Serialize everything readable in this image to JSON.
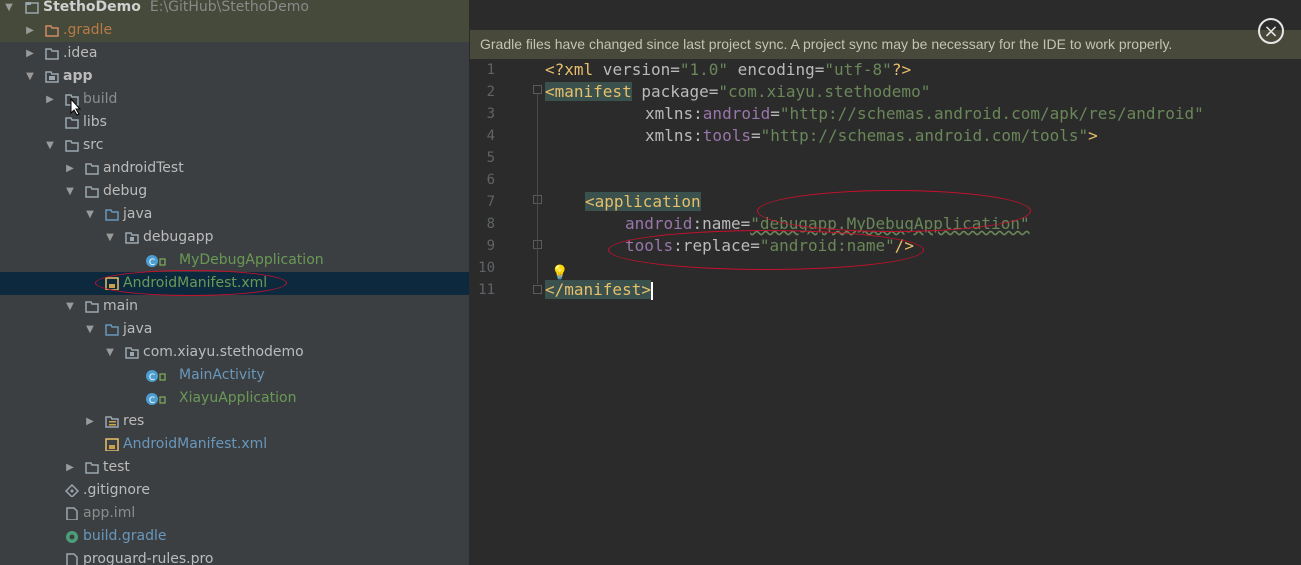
{
  "project_tree": {
    "rows": [
      {
        "label": "StethoDemo",
        "path": "E:\\GitHub\\StethoDemo",
        "type": "project"
      },
      {
        "label": ".gradle",
        "type": "folder"
      },
      {
        "label": ".idea",
        "type": "folder"
      },
      {
        "label": "app",
        "type": "module"
      },
      {
        "label": "build",
        "type": "folder"
      },
      {
        "label": "libs",
        "type": "folder"
      },
      {
        "label": "src",
        "type": "folder"
      },
      {
        "label": "androidTest",
        "type": "folder"
      },
      {
        "label": "debug",
        "type": "folder"
      },
      {
        "label": "java",
        "type": "folder"
      },
      {
        "label": "debugapp",
        "type": "package"
      },
      {
        "label": "MyDebugApplication",
        "type": "class"
      },
      {
        "label": "AndroidManifest.xml",
        "type": "xml",
        "selected": true
      },
      {
        "label": "main",
        "type": "folder"
      },
      {
        "label": "java",
        "type": "folder"
      },
      {
        "label": "com.xiayu.stethodemo",
        "type": "package"
      },
      {
        "label": "MainActivity",
        "type": "class"
      },
      {
        "label": "XiayuApplication",
        "type": "class"
      },
      {
        "label": "res",
        "type": "folder"
      },
      {
        "label": "AndroidManifest.xml",
        "type": "xml"
      },
      {
        "label": "test",
        "type": "folder"
      },
      {
        "label": ".gitignore",
        "type": "file"
      },
      {
        "label": "app.iml",
        "type": "file"
      },
      {
        "label": "build.gradle",
        "type": "gradle"
      },
      {
        "label": "proguard-rules.pro",
        "type": "file"
      }
    ]
  },
  "editor": {
    "notification": "Gradle files have changed since last project sync. A project sync may be necessary for the IDE to work properly.",
    "close_icon": "×",
    "line_numbers": [
      "1",
      "2",
      "3",
      "4",
      "5",
      "6",
      "7",
      "8",
      "9",
      "10",
      "11"
    ],
    "code": {
      "l1": {
        "a": "<?",
        "b": "xml",
        " c": "",
        "c": " version=",
        "d": "\"1.0\"",
        "e": " encoding=",
        "f": "\"utf-8\"",
        "g": "?>"
      },
      "l2": {
        "a": "<manifest",
        "b": " package=",
        "c": "\"com.xiayu.stethodemo\""
      },
      "l3": {
        "a": "xmlns:",
        "b": "android",
        "c": "=",
        "d": "\"http://schemas.android.com/apk/res/android\""
      },
      "l4": {
        "a": "xmlns:",
        "b": "tools",
        "c": "=",
        "d": "\"http://schemas.android.com/tools\"",
        "e": ">"
      },
      "l7": {
        "a": "<application"
      },
      "l8": {
        "a": "android",
        "b": ":name=",
        "c": "\"debugapp.MyDebugApplication\""
      },
      "l9": {
        "a": "tools",
        "b": ":replace=",
        "c": "\"android:name\"",
        "d": "/>"
      },
      "l11": {
        "a": "</manifest>"
      }
    }
  },
  "colors": {
    "annotation": "#c8102e",
    "selection": "#0d293e"
  }
}
